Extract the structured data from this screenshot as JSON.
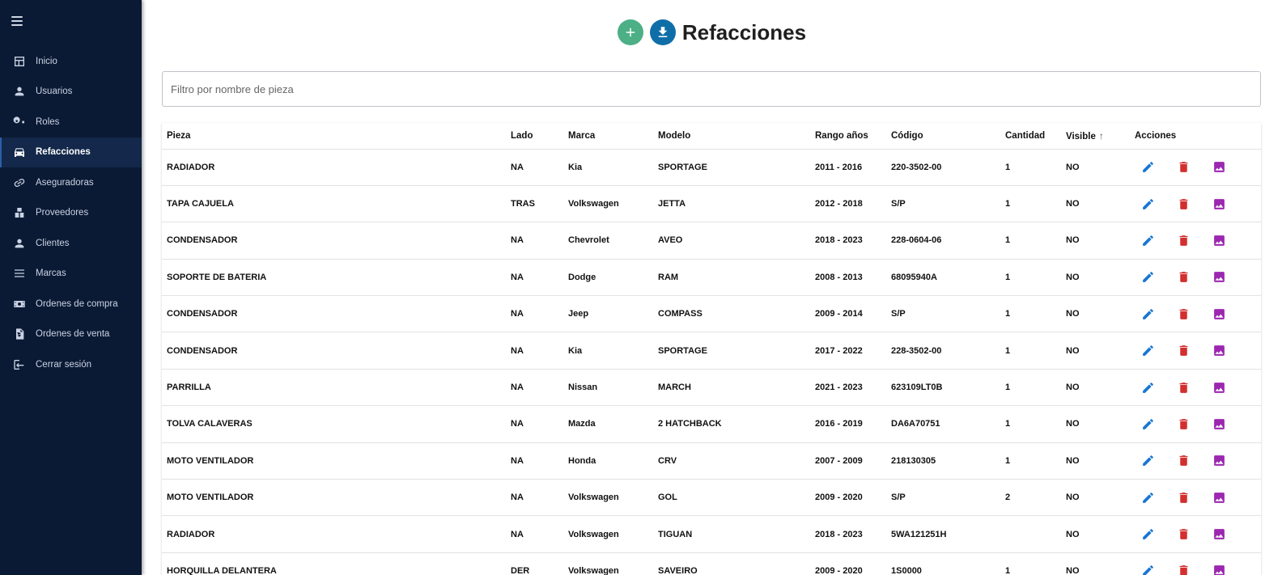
{
  "sidebar": {
    "items": [
      {
        "label": "Inicio",
        "icon": "dashboard-icon"
      },
      {
        "label": "Usuarios",
        "icon": "person-icon"
      },
      {
        "label": "Roles",
        "icon": "key-icon"
      },
      {
        "label": "Refacciones",
        "icon": "car-icon",
        "active": true
      },
      {
        "label": "Aseguradoras",
        "icon": "link-icon"
      },
      {
        "label": "Proveedores",
        "icon": "boxes-icon"
      },
      {
        "label": "Clientes",
        "icon": "person-icon"
      },
      {
        "label": "Marcas",
        "icon": "list-icon"
      },
      {
        "label": "Ordenes de compra",
        "icon": "money-icon"
      },
      {
        "label": "Ordenes de venta",
        "icon": "receipt-icon"
      },
      {
        "label": "Cerrar sesión",
        "icon": "logout-icon"
      }
    ]
  },
  "header": {
    "title": "Refacciones"
  },
  "filter": {
    "placeholder": "Filtro por nombre de pieza",
    "value": ""
  },
  "table": {
    "columns": [
      "Pieza",
      "Lado",
      "Marca",
      "Modelo",
      "Rango años",
      "Código",
      "Cantidad",
      "Visible",
      "Acciones"
    ],
    "rows": [
      [
        "RADIADOR",
        "NA",
        "Kia",
        "SPORTAGE",
        "2011 - 2016",
        "220-3502-00",
        "1",
        "NO"
      ],
      [
        "TAPA CAJUELA",
        "TRAS",
        "Volkswagen",
        "JETTA",
        "2012 - 2018",
        "S/P",
        "1",
        "NO"
      ],
      [
        "CONDENSADOR",
        "NA",
        "Chevrolet",
        "AVEO",
        "2018 - 2023",
        "228-0604-06",
        "1",
        "NO"
      ],
      [
        "SOPORTE DE BATERIA",
        "NA",
        "Dodge",
        "RAM",
        "2008 - 2013",
        "68095940A",
        "1",
        "NO"
      ],
      [
        "CONDENSADOR",
        "NA",
        "Jeep",
        "COMPASS",
        "2009 - 2014",
        "S/P",
        "1",
        "NO"
      ],
      [
        "CONDENSADOR",
        "NA",
        "Kia",
        "SPORTAGE",
        "2017 - 2022",
        "228-3502-00",
        "1",
        "NO"
      ],
      [
        "PARRILLA",
        "NA",
        "Nissan",
        "MARCH",
        "2021 - 2023",
        "623109LT0B",
        "1",
        "NO"
      ],
      [
        "TOLVA CALAVERAS",
        "NA",
        "Mazda",
        "2 HATCHBACK",
        "2016 - 2019",
        "DA6A70751",
        "1",
        "NO"
      ],
      [
        "MOTO VENTILADOR",
        "NA",
        "Honda",
        "CRV",
        "2007 - 2009",
        "218130305",
        "1",
        "NO"
      ],
      [
        "MOTO VENTILADOR",
        "NA",
        "Volkswagen",
        "GOL",
        "2009 - 2020",
        "S/P",
        "2",
        "NO"
      ],
      [
        "RADIADOR",
        "NA",
        "Volkswagen",
        "TIGUAN",
        "2018 - 2023",
        "5WA121251H",
        "",
        "NO"
      ],
      [
        "HORQUILLA DELANTERA",
        "DER",
        "Volkswagen",
        "SAVEIRO",
        "2009 - 2020",
        "1S0000",
        "1",
        "NO"
      ]
    ]
  },
  "colors": {
    "sidebar_bg": "#0b1a34",
    "add_button": "#4caf86",
    "download_button": "#0f6ea8",
    "edit_icon": "#1976d2",
    "delete_icon": "#d32f2f",
    "image_icon": "#9c27b0"
  }
}
